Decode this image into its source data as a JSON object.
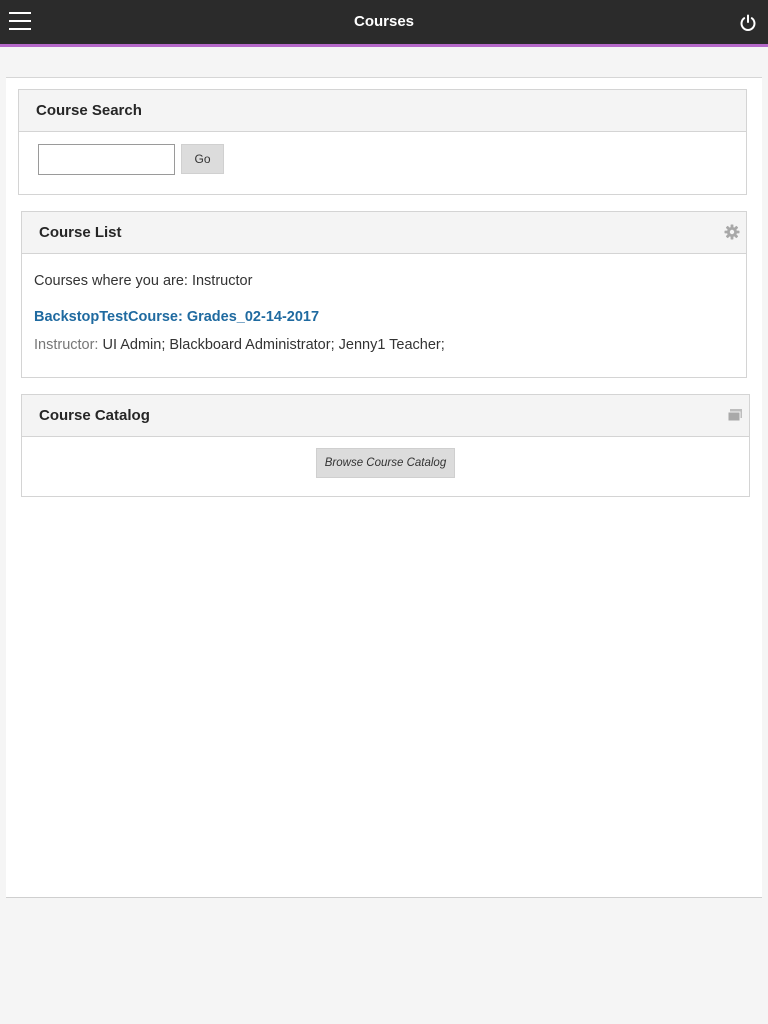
{
  "header": {
    "title": "Courses",
    "menu_icon": "hamburger-menu-icon",
    "power_icon": "power-icon",
    "accent_color": "#b568c9",
    "background": "#2b2b2b"
  },
  "course_search": {
    "title": "Course Search",
    "input_value": "",
    "go_label": "Go"
  },
  "course_list": {
    "title": "Course List",
    "settings_icon": "gear-icon",
    "role_text": "Courses where you are: Instructor",
    "course_title": "BackstopTestCourse: Grades_02-14-2017",
    "instructor_label": "Instructor:",
    "instructors": " UI Admin;  Blackboard Administrator;  Jenny1 Teacher;",
    "link_color": "#1f6aa0"
  },
  "course_catalog": {
    "title": "Course Catalog",
    "window_icon": "window-icon",
    "browse_label": "Browse Course Catalog"
  }
}
